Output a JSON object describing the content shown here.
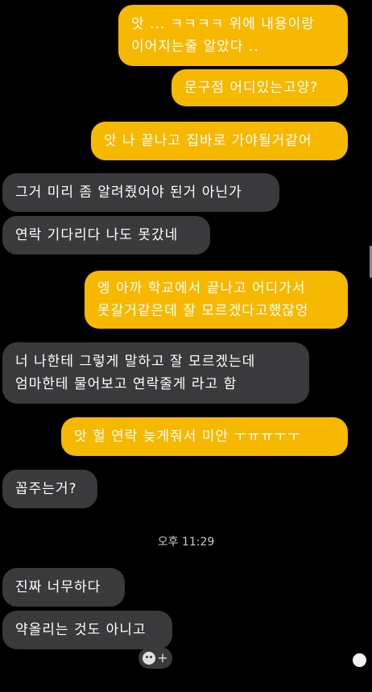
{
  "messages": [
    {
      "side": "sent",
      "text": "앗 ... ㅋㅋㅋㅋ 위에 내용이랑\n이어지는줄 알았다 .."
    },
    {
      "side": "sent",
      "text": "문구점 어디있는고양?"
    },
    {
      "side": "sent",
      "text": "앗 나 끝나고 집바로 가야될거같어"
    },
    {
      "side": "recv",
      "text": "그거 미리 좀 알려줬어야 된거 아닌가"
    },
    {
      "side": "recv",
      "text": "연락 기다리다 나도 못갔네"
    },
    {
      "side": "sent",
      "text": "엥 아까 학교에서 끝나고 어디가서\n못갈거같은데 잘 모르겠다고했잖엉"
    },
    {
      "side": "recv",
      "text": "너 나한테 그렇게 말하고 잘 모르겠는데\n엄마한테 물어보고 연락줄게 라고 함"
    },
    {
      "side": "sent",
      "text": "앗 헐 연락 늦게줘서 미안 ㅜㅠㅠㅜㅜ"
    },
    {
      "side": "recv",
      "text": "꼽주는거?"
    },
    {
      "side": "recv",
      "text": "진짜 너무하다"
    },
    {
      "side": "recv",
      "text": "약올리는 것도 아니고"
    }
  ],
  "timestamp": "오후 11:29",
  "emoji_button": {
    "icon": "smiley-plus-icon"
  },
  "colors": {
    "sent": "#f6b800",
    "received": "#3a3a3c",
    "background": "#000000"
  }
}
